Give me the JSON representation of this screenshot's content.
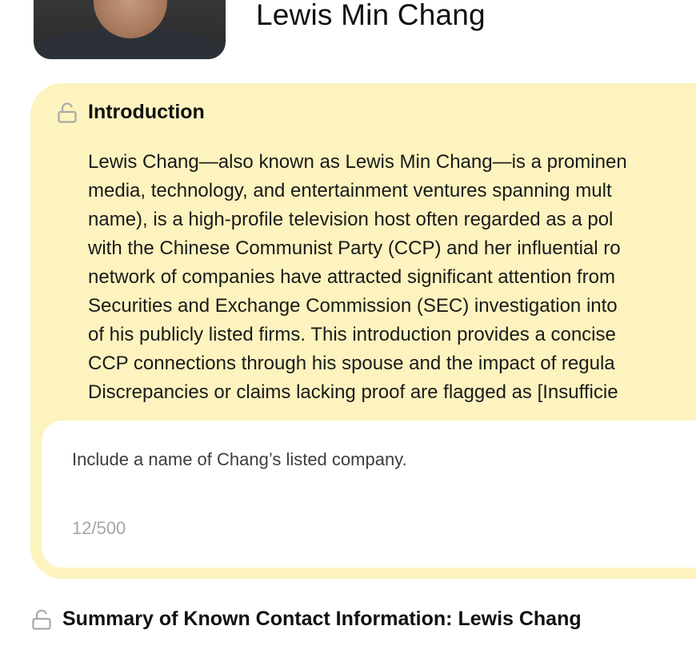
{
  "profile": {
    "name": "Lewis Min Chang"
  },
  "introduction": {
    "icon": "unlock-icon",
    "title": "Introduction",
    "lines": [
      "Lewis Chang—also known as Lewis Min Chang—is a prominen",
      "media, technology, and entertainment ventures spanning mult",
      "name), is a high-profile television host often regarded as a pol",
      "with the Chinese Communist Party (CCP) and her influential ro",
      "network of companies have attracted significant attention from",
      "Securities and Exchange Commission (SEC) investigation into",
      "of his publicly listed firms. This introduction provides a concise",
      "CCP connections through his spouse and the impact of regula",
      "Discrepancies or claims lacking proof are flagged as [Insufficie"
    ]
  },
  "feedback": {
    "text": "Include a name of Chang’s listed company.",
    "count": "12/500"
  },
  "summary_section": {
    "icon": "unlock-icon",
    "title": "Summary of Known Contact Information: Lewis Chang"
  },
  "colors": {
    "card_background": "#fdf3bf",
    "lock_icon": "#a8a8a8"
  }
}
